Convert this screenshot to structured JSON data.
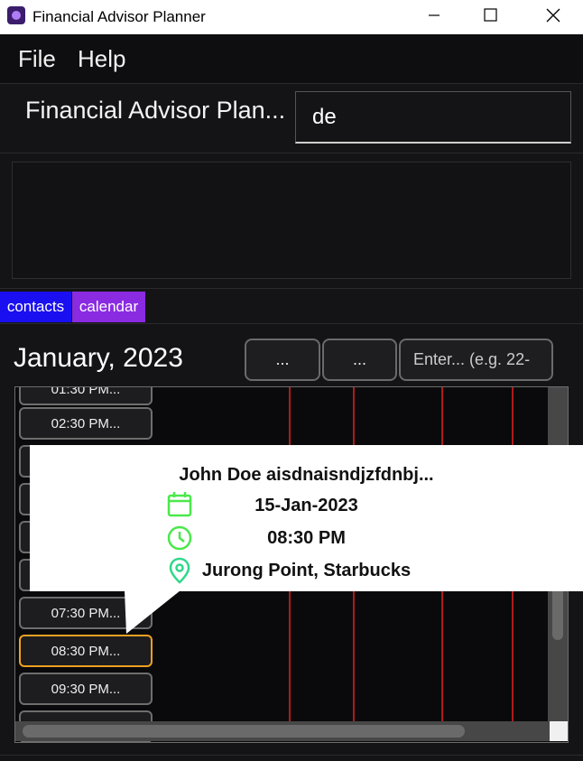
{
  "window": {
    "title": "Financial Advisor Planner",
    "controls": [
      "minimize",
      "maximize",
      "close"
    ]
  },
  "menu": {
    "items": [
      "File",
      "Help"
    ]
  },
  "header": {
    "title": "Financial Advisor Plan...",
    "command_input_value": "de"
  },
  "result_display": {
    "text": ""
  },
  "tabs": [
    {
      "label": "contacts",
      "color": "#1a0ff0",
      "selected": false
    },
    {
      "label": "calendar",
      "color": "#8a2be2",
      "selected": true
    }
  ],
  "calendar": {
    "month_label": "January, 2023",
    "prev_label": "...",
    "next_label": "...",
    "date_input_placeholder": "Enter... (e.g. 22-",
    "time_slots": [
      "01:30 PM...",
      "02:30 PM...",
      "",
      "",
      "",
      "",
      "07:30 PM...",
      "08:30 PM...",
      "09:30 PM...",
      ""
    ],
    "active_slot": "08:30 PM..."
  },
  "popup": {
    "title": "John Doe aisdnaisndjzfdnbj...",
    "date": "15-Jan-2023",
    "time": "08:30 PM",
    "location": "Jurong Point, Starbucks",
    "icon_color": "#4be84b"
  },
  "colors": {
    "accent_red_line": "#b01a1a",
    "active_slot_border": "#f0a020"
  }
}
